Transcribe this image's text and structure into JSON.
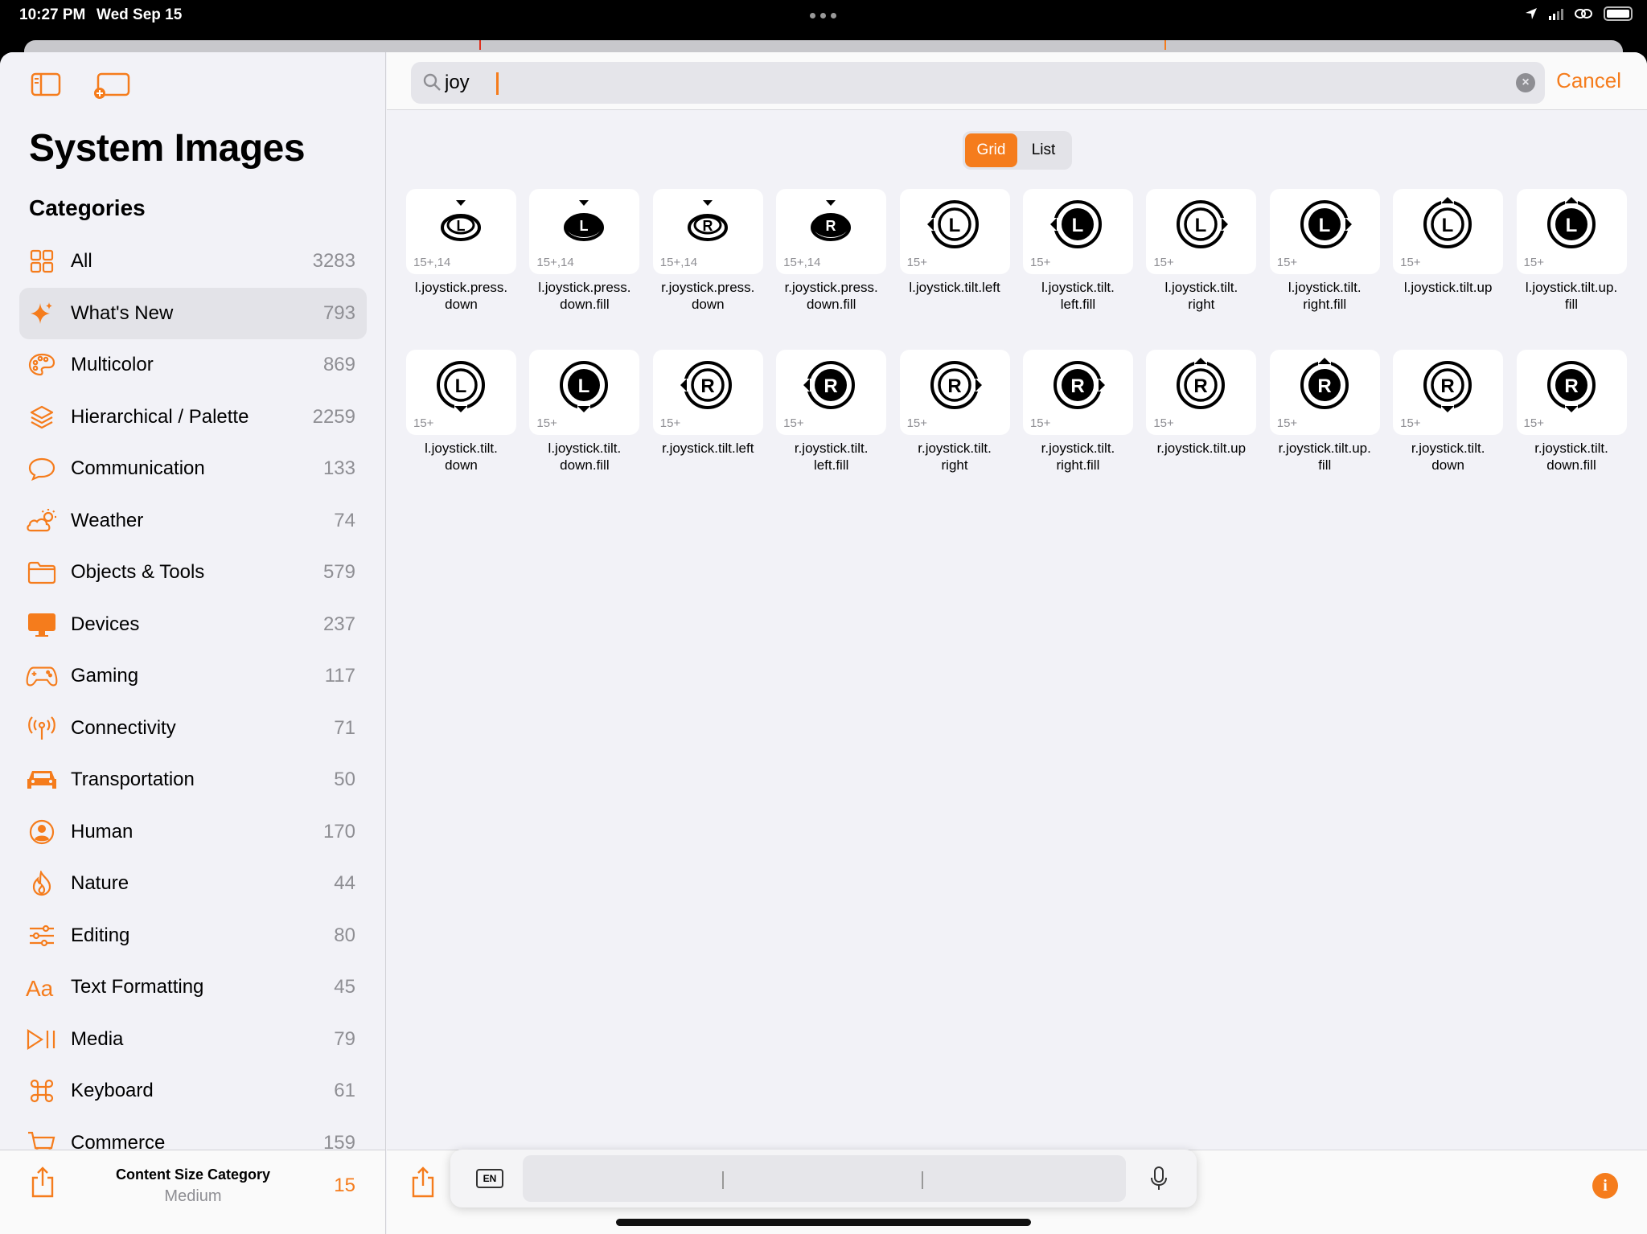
{
  "status": {
    "time": "10:27 PM",
    "date": "Wed Sep 15"
  },
  "sidebar": {
    "title": "System Images",
    "section": "Categories",
    "items": [
      {
        "label": "All",
        "count": "3283",
        "icon": "grid-icon"
      },
      {
        "label": "What's New",
        "count": "793",
        "icon": "sparkle-icon",
        "selected": true
      },
      {
        "label": "Multicolor",
        "count": "869",
        "icon": "palette-icon"
      },
      {
        "label": "Hierarchical / Palette",
        "count": "2259",
        "icon": "layers-icon"
      },
      {
        "label": "Communication",
        "count": "133",
        "icon": "bubble-icon"
      },
      {
        "label": "Weather",
        "count": "74",
        "icon": "cloud-sun-icon"
      },
      {
        "label": "Objects & Tools",
        "count": "579",
        "icon": "folder-icon"
      },
      {
        "label": "Devices",
        "count": "237",
        "icon": "desktop-icon"
      },
      {
        "label": "Gaming",
        "count": "117",
        "icon": "gamecontroller-icon"
      },
      {
        "label": "Connectivity",
        "count": "71",
        "icon": "antenna-icon"
      },
      {
        "label": "Transportation",
        "count": "50",
        "icon": "car-icon"
      },
      {
        "label": "Human",
        "count": "170",
        "icon": "person-icon"
      },
      {
        "label": "Nature",
        "count": "44",
        "icon": "flame-icon"
      },
      {
        "label": "Editing",
        "count": "80",
        "icon": "sliders-icon"
      },
      {
        "label": "Text Formatting",
        "count": "45",
        "icon": "textformat-icon"
      },
      {
        "label": "Media",
        "count": "79",
        "icon": "playpause-icon"
      },
      {
        "label": "Keyboard",
        "count": "61",
        "icon": "command-icon"
      },
      {
        "label": "Commerce",
        "count": "159",
        "icon": "cart-icon"
      }
    ],
    "bottom": {
      "label": "Content Size Category",
      "value": "Medium",
      "number": "15"
    }
  },
  "search": {
    "value": "joy",
    "cancel": "Cancel"
  },
  "view_toggle": {
    "grid": "Grid",
    "list": "List",
    "selected": "Grid"
  },
  "symbols": [
    {
      "name": "l.joystick.press.\ndown",
      "avail": "15+,14",
      "letter": "L",
      "style": "press",
      "fill": false
    },
    {
      "name": "l.joystick.press.\ndown.fill",
      "avail": "15+,14",
      "letter": "L",
      "style": "press",
      "fill": true
    },
    {
      "name": "r.joystick.press.\ndown",
      "avail": "15+,14",
      "letter": "R",
      "style": "press",
      "fill": false
    },
    {
      "name": "r.joystick.press.\ndown.fill",
      "avail": "15+,14",
      "letter": "R",
      "style": "press",
      "fill": true
    },
    {
      "name": "l.joystick.tilt.left",
      "avail": "15+",
      "letter": "L",
      "style": "left",
      "fill": false
    },
    {
      "name": "l.joystick.tilt.\nleft.fill",
      "avail": "15+",
      "letter": "L",
      "style": "left",
      "fill": true
    },
    {
      "name": "l.joystick.tilt.\nright",
      "avail": "15+",
      "letter": "L",
      "style": "right",
      "fill": false
    },
    {
      "name": "l.joystick.tilt.\nright.fill",
      "avail": "15+",
      "letter": "L",
      "style": "right",
      "fill": true
    },
    {
      "name": "l.joystick.tilt.up",
      "avail": "15+",
      "letter": "L",
      "style": "up",
      "fill": false
    },
    {
      "name": "l.joystick.tilt.up.\nfill",
      "avail": "15+",
      "letter": "L",
      "style": "up",
      "fill": true
    },
    {
      "name": "l.joystick.tilt.\ndown",
      "avail": "15+",
      "letter": "L",
      "style": "down",
      "fill": false
    },
    {
      "name": "l.joystick.tilt.\ndown.fill",
      "avail": "15+",
      "letter": "L",
      "style": "down",
      "fill": true
    },
    {
      "name": "r.joystick.tilt.left",
      "avail": "15+",
      "letter": "R",
      "style": "left",
      "fill": false
    },
    {
      "name": "r.joystick.tilt.\nleft.fill",
      "avail": "15+",
      "letter": "R",
      "style": "left",
      "fill": true
    },
    {
      "name": "r.joystick.tilt.\nright",
      "avail": "15+",
      "letter": "R",
      "style": "right",
      "fill": false
    },
    {
      "name": "r.joystick.tilt.\nright.fill",
      "avail": "15+",
      "letter": "R",
      "style": "right",
      "fill": true
    },
    {
      "name": "r.joystick.tilt.up",
      "avail": "15+",
      "letter": "R",
      "style": "up",
      "fill": false
    },
    {
      "name": "r.joystick.tilt.up.\nfill",
      "avail": "15+",
      "letter": "R",
      "style": "up",
      "fill": true
    },
    {
      "name": "r.joystick.tilt.\ndown",
      "avail": "15+",
      "letter": "R",
      "style": "down",
      "fill": false
    },
    {
      "name": "r.joystick.tilt.\ndown.fill",
      "avail": "15+",
      "letter": "R",
      "style": "down",
      "fill": true
    }
  ],
  "keyboard_bar": {
    "lang": "EN"
  },
  "colors": {
    "accent": "#f57c1c",
    "background": "#f2f2f7",
    "selected_row": "#e3e3e8"
  }
}
